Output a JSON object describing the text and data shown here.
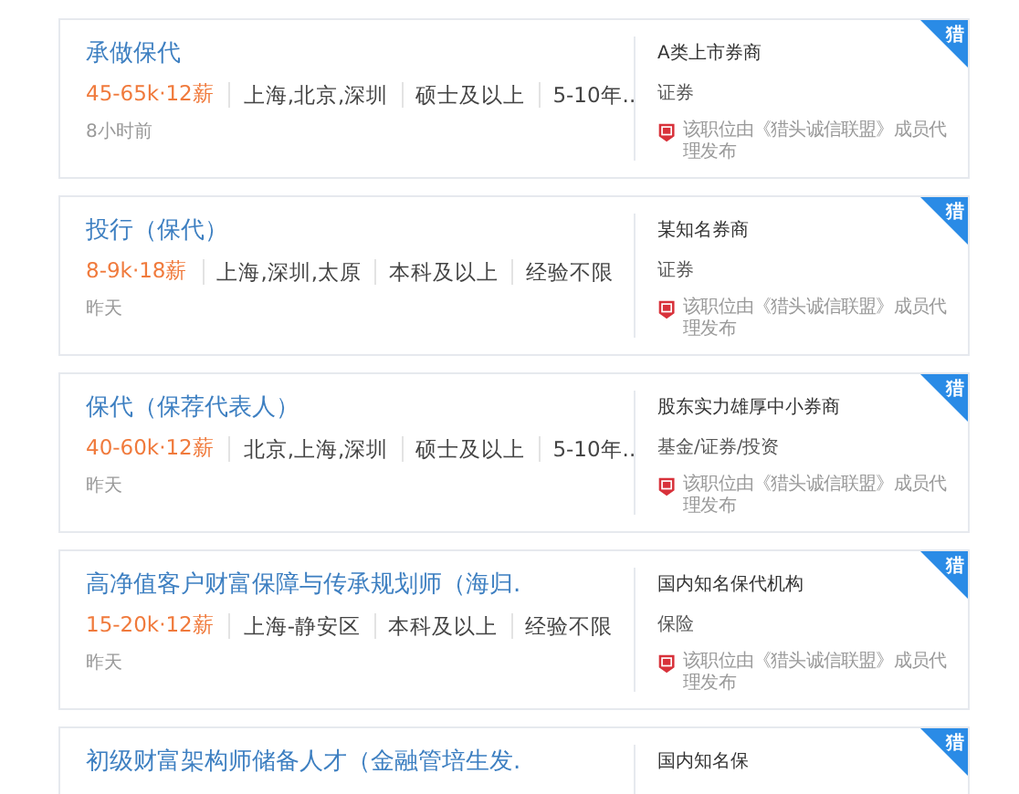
{
  "jobs": [
    {
      "title": "承做保代",
      "salary": "45-65k·12薪",
      "tags": [
        "上海,北京,深圳",
        "硕士及以上",
        "5-10年.."
      ],
      "time": "8小时前",
      "company": "A类上市券商",
      "industry": "证券",
      "notice": "该职位由《猎头诚信联盟》成员代理发布",
      "badge": "猎"
    },
    {
      "title": "投行（保代）",
      "salary": "8-9k·18薪",
      "tags": [
        "上海,深圳,太原",
        "本科及以上",
        "经验不限"
      ],
      "time": "昨天",
      "company": "某知名券商",
      "industry": "证券",
      "notice": "该职位由《猎头诚信联盟》成员代理发布",
      "badge": "猎"
    },
    {
      "title": "保代（保荐代表人）",
      "salary": "40-60k·12薪",
      "tags": [
        "北京,上海,深圳",
        "硕士及以上",
        "5-10年.."
      ],
      "time": "昨天",
      "company": "股东实力雄厚中小券商",
      "industry": "基金/证券/投资",
      "notice": "该职位由《猎头诚信联盟》成员代理发布",
      "badge": "猎"
    },
    {
      "title": "高净值客户财富保障与传承规划师（海归.",
      "salary": "15-20k·12薪",
      "tags": [
        "上海-静安区",
        "本科及以上",
        "经验不限"
      ],
      "time": "昨天",
      "company": "国内知名保代机构",
      "industry": "保险",
      "notice": "该职位由《猎头诚信联盟》成员代理发布",
      "badge": "猎"
    },
    {
      "title": "初级财富架构师储备人才（金融管培生发.",
      "company": "国内知名保",
      "badge": "猎"
    }
  ]
}
